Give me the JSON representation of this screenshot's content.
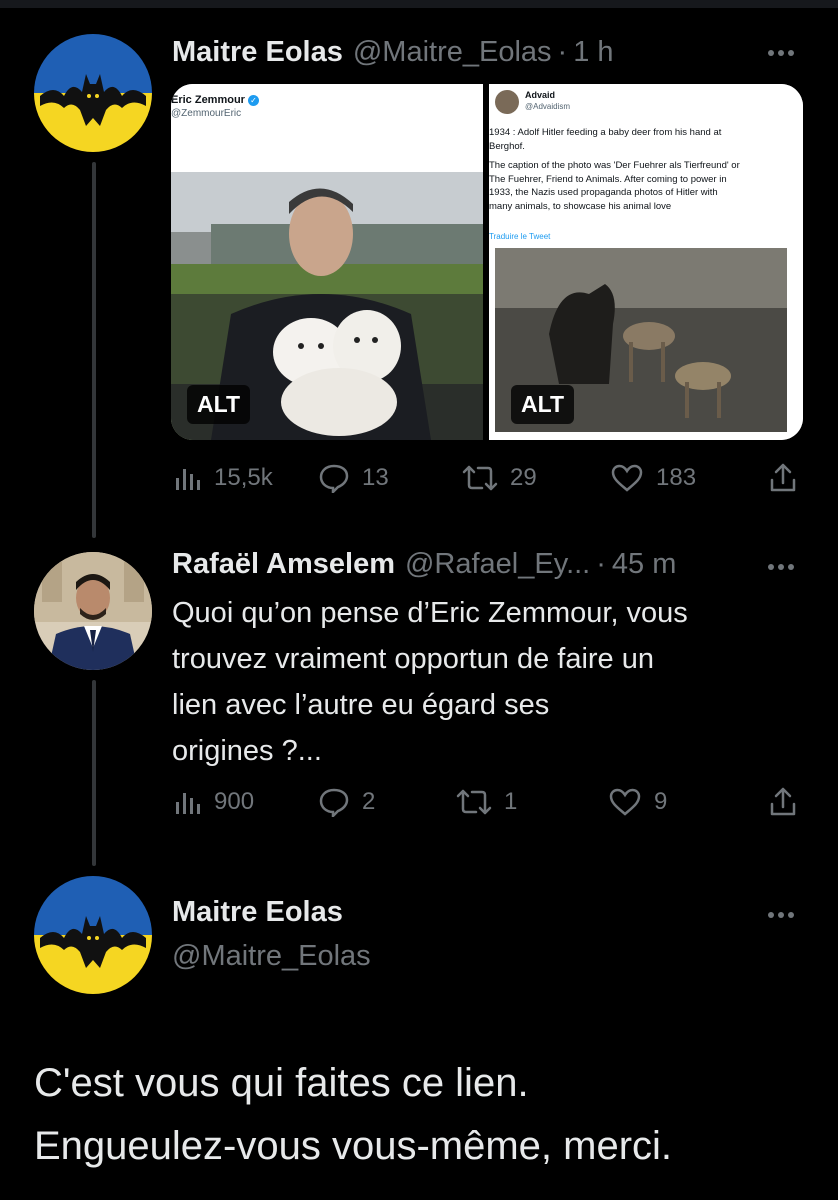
{
  "tweet1": {
    "name": "Maitre Eolas",
    "handle": "@Maitre_Eolas",
    "time": "1 h",
    "media": [
      {
        "author": "Eric Zemmour",
        "author_handle": "@ZemmourEric",
        "alt_label": "ALT"
      },
      {
        "author": "Advaid",
        "author_handle": "@Advaidism",
        "text_lines": [
          "1934 : Adolf Hitler feeding a baby deer from his hand at",
          "Berghof.",
          "The caption of the photo was 'Der Fuehrer als Tierfreund' or",
          "The Fuehrer, Friend to Animals. After coming to power in",
          "1933, the Nazis used propaganda photos of Hitler with",
          "many animals, to showcase his animal love"
        ],
        "translate": "Traduire le Tweet",
        "alt_label": "ALT"
      }
    ],
    "stats": {
      "views": "15,5k",
      "replies": "13",
      "retweets": "29",
      "likes": "183"
    }
  },
  "tweet2": {
    "name": "Rafaël Amselem",
    "handle": "@Rafael_Ey...",
    "time": "45 m",
    "text_lines": [
      "Quoi qu’on pense d’Eric Zemmour, vous",
      "trouvez vraiment opportun de faire un",
      "lien avec l’autre eu égard ses",
      "origines ?..."
    ],
    "stats": {
      "views": "900",
      "replies": "2",
      "retweets": "1",
      "likes": "9"
    }
  },
  "tweet3": {
    "name": "Maitre Eolas",
    "handle": "@Maitre_Eolas",
    "text_lines": [
      "C'est vous qui faites ce lien.",
      "Engueulez-vous vous-même, merci."
    ]
  },
  "colors": {
    "background": "#000000",
    "text_primary": "#e7e9ea",
    "text_secondary": "#71767b",
    "thread_line": "#333639",
    "verified": "#1d9bf0",
    "avatar_blue": "#1f5fb4",
    "avatar_yellow": "#f5d622"
  },
  "icons": [
    "views-icon",
    "reply-icon",
    "retweet-icon",
    "like-icon",
    "share-icon",
    "more-icon",
    "verified-icon"
  ]
}
